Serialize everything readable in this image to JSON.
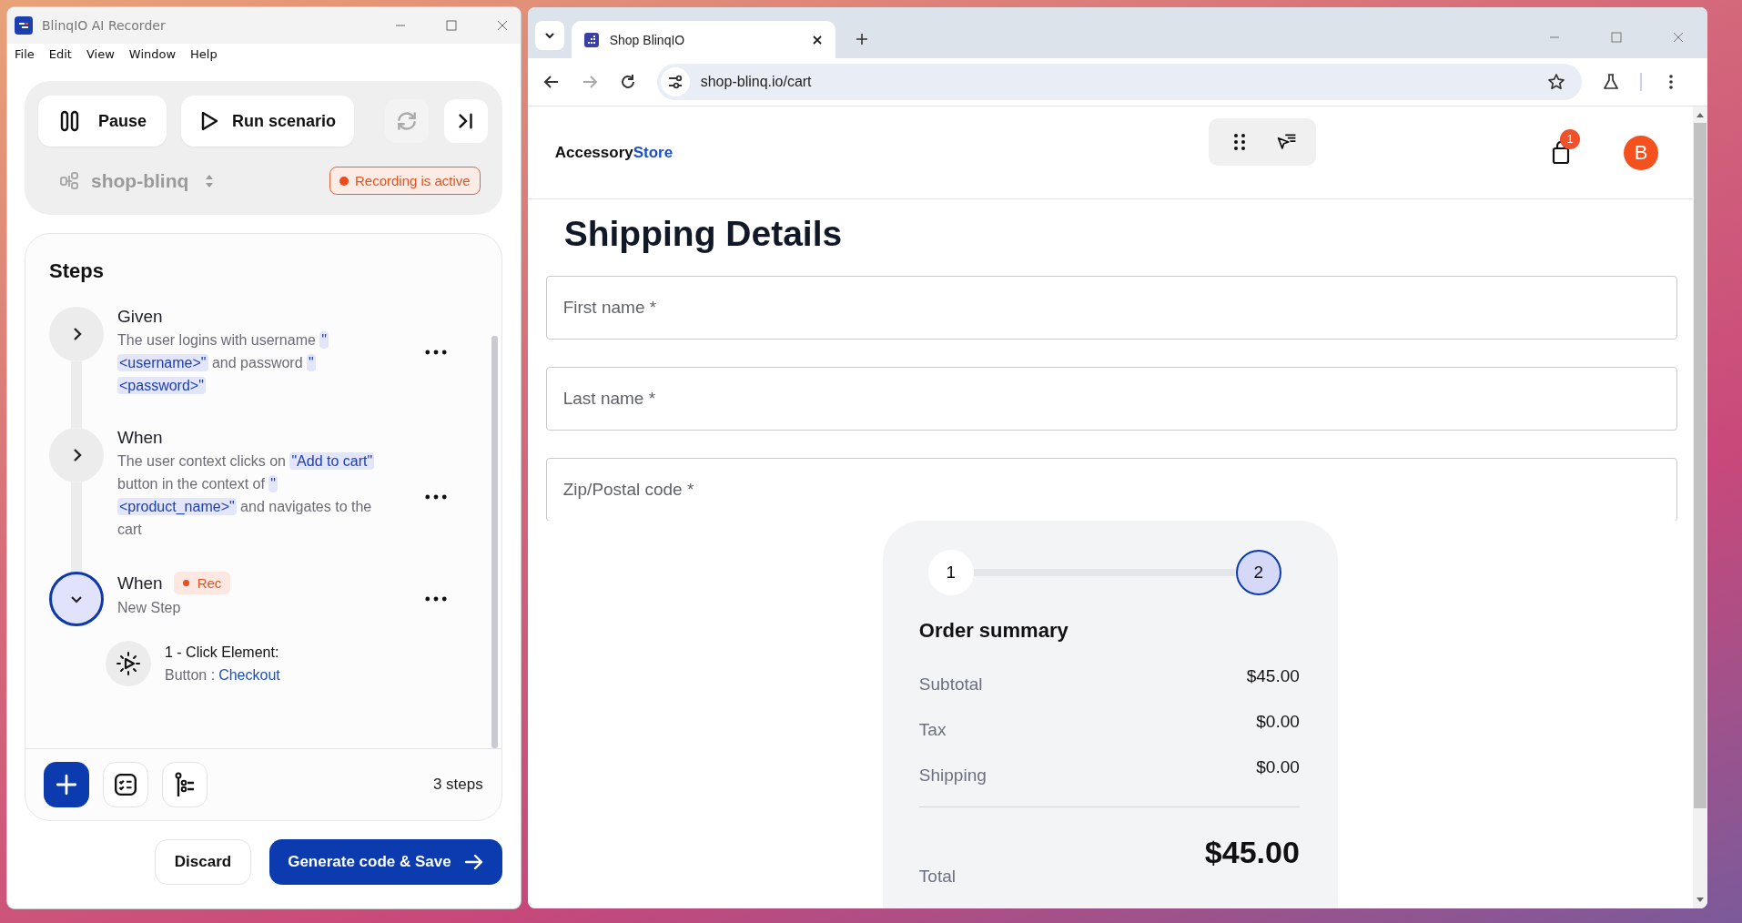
{
  "recorder": {
    "title": "BlinqIO AI Recorder",
    "menu": [
      "File",
      "Edit",
      "View",
      "Window",
      "Help"
    ],
    "pause": "Pause",
    "run": "Run scenario",
    "project": "shop-blinq",
    "status": "Recording is active",
    "steps_title": "Steps",
    "steps": [
      {
        "keyword": "Given",
        "expanded": false,
        "text": [
          {
            "t": "The user logins with username ",
            "kind": "plain"
          },
          {
            "t": "\"<username>\"",
            "kind": "param"
          },
          {
            "t": " and password ",
            "kind": "plain"
          },
          {
            "t": "\"<password>\"",
            "kind": "param"
          }
        ]
      },
      {
        "keyword": "When",
        "expanded": false,
        "text": [
          {
            "t": "The user context clicks on ",
            "kind": "plain"
          },
          {
            "t": "\"Add to cart\"",
            "kind": "param"
          },
          {
            "t": " button in the context of ",
            "kind": "plain"
          },
          {
            "t": "\"<product_name>\"",
            "kind": "param"
          },
          {
            "t": " and navigates to the cart",
            "kind": "plain"
          }
        ]
      },
      {
        "keyword": "When",
        "expanded": true,
        "badge": "Rec",
        "text": [
          {
            "t": "New Step",
            "kind": "plain"
          }
        ],
        "actions": [
          {
            "title": "1 - Click Element:",
            "label": "Button :",
            "target": "Checkout"
          }
        ]
      }
    ],
    "step_count": "3 steps",
    "discard": "Discard",
    "generate": "Generate code & Save"
  },
  "browser": {
    "tab_title": "Shop BlinqIO",
    "url": "shop-blinq.io/cart",
    "brand": "Accessory",
    "brand_accent": "Store",
    "cart_count": "1",
    "avatar": "B",
    "heading": "Shipping Details",
    "fields": [
      {
        "placeholder": "First name *"
      },
      {
        "placeholder": "Last name *"
      },
      {
        "placeholder": "Zip/Postal code *"
      }
    ],
    "stepper": [
      {
        "label": "1",
        "selected": false
      },
      {
        "label": "2",
        "selected": true
      }
    ],
    "summary": {
      "title": "Order summary",
      "rows": [
        {
          "label": "Subtotal",
          "value": "$45.00"
        },
        {
          "label": "Tax",
          "value": "$0.00"
        },
        {
          "label": "Shipping",
          "value": "$0.00"
        }
      ],
      "total_label": "Total",
      "total_value": "$45.00"
    }
  }
}
